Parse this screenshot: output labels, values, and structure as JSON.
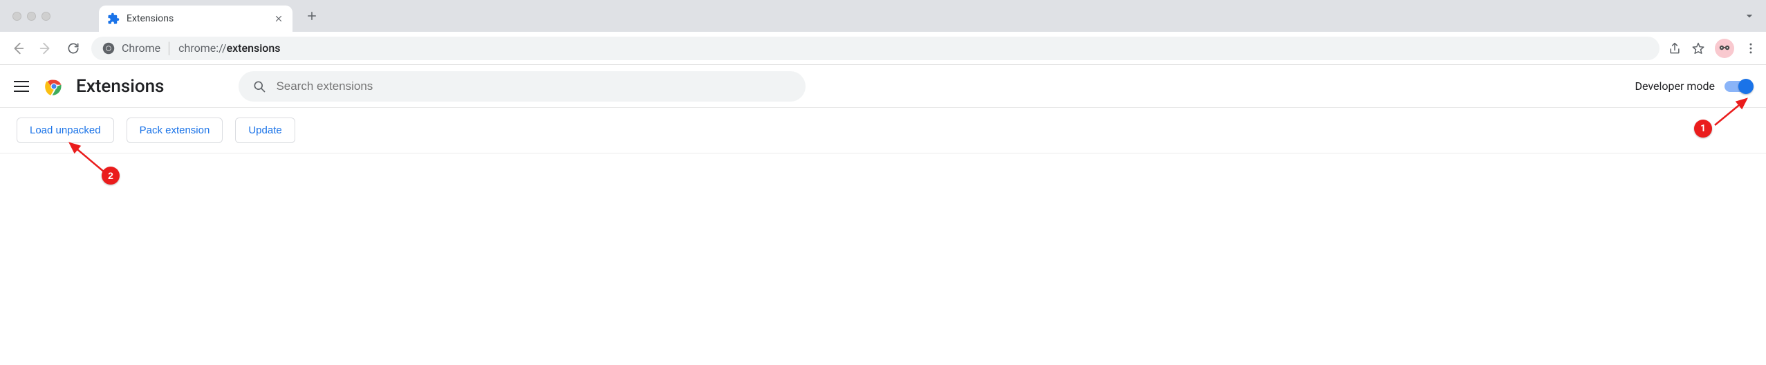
{
  "tab": {
    "title": "Extensions"
  },
  "omnibox": {
    "label": "Chrome",
    "scheme": "chrome://",
    "path_strong": "extensions"
  },
  "page": {
    "title": "Extensions",
    "search_placeholder": "Search extensions",
    "developer_mode_label": "Developer mode"
  },
  "dev_buttons": {
    "load_unpacked": "Load unpacked",
    "pack_extension": "Pack extension",
    "update": "Update"
  },
  "annotations": {
    "badge1": "1",
    "badge2": "2"
  }
}
